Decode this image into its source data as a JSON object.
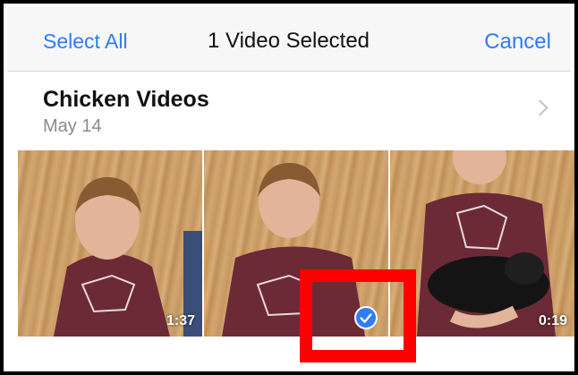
{
  "navbar": {
    "select_all": "Select All",
    "title": "1 Video Selected",
    "cancel": "Cancel"
  },
  "album": {
    "title": "Chicken Videos",
    "date": "May 14"
  },
  "thumbnails": [
    {
      "duration": "1:37",
      "selected": false
    },
    {
      "duration": "",
      "selected": true
    },
    {
      "duration": "0:19",
      "selected": false
    }
  ],
  "colors": {
    "accent": "#2f7cf6",
    "highlight": "#ff0000",
    "shirt": "#6b2a36"
  },
  "icons": {
    "album_chevron": "chevron-right-icon",
    "selection": "checkmark-circle-icon"
  }
}
